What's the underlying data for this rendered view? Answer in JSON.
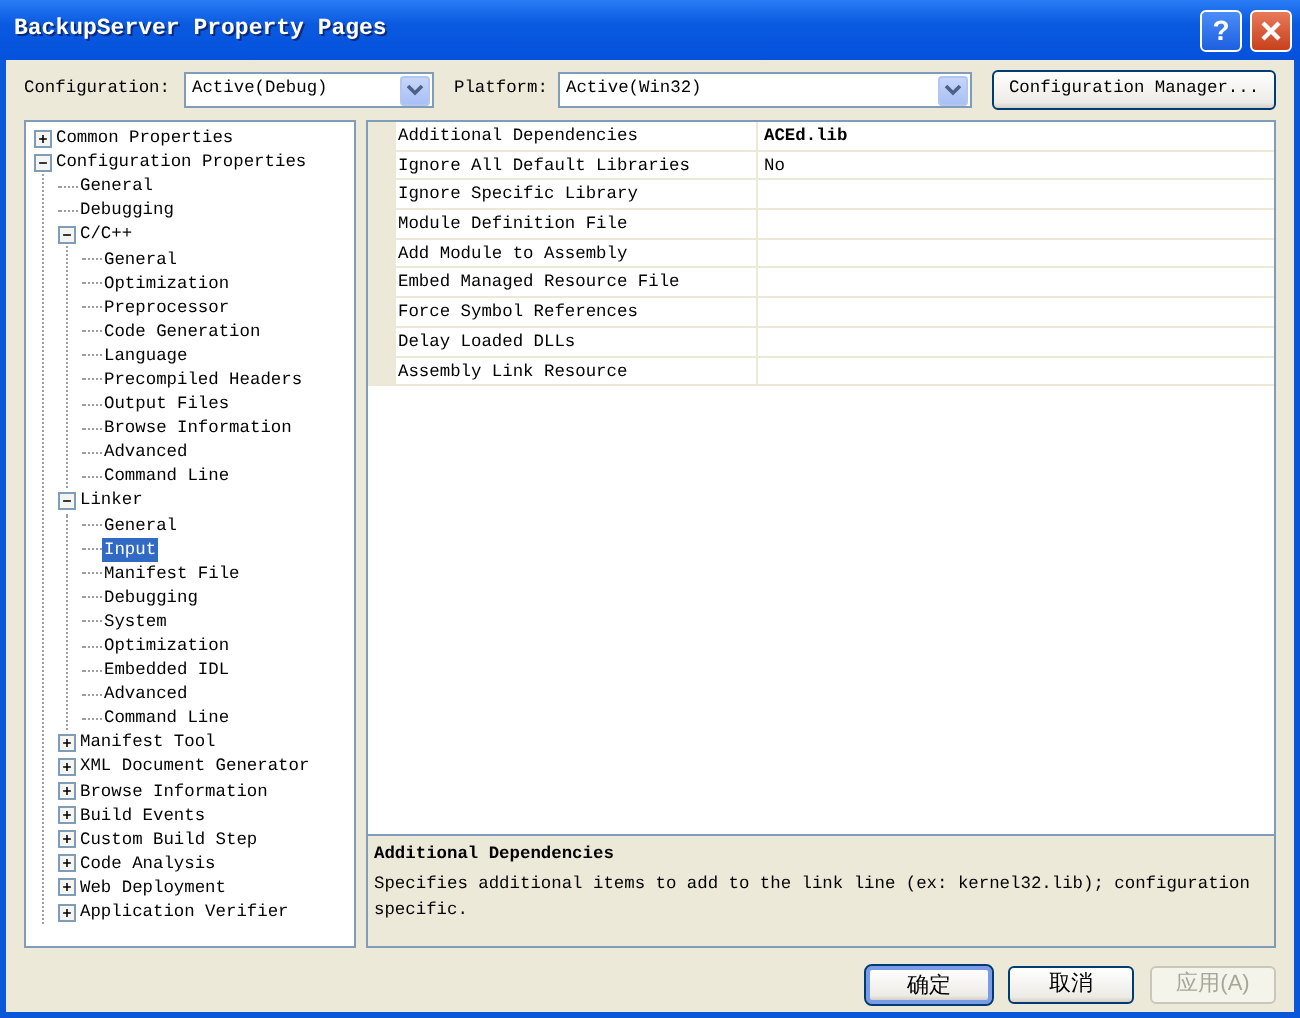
{
  "window": {
    "title": "BackupServer Property Pages",
    "help": "?"
  },
  "toolbar": {
    "configuration_label": "Configuration:",
    "configuration_value": "Active(Debug)",
    "platform_label": "Platform:",
    "platform_value": "Active(Win32)",
    "manager_button": "Configuration Manager..."
  },
  "tree": [
    {
      "label": "Common Properties",
      "expanded": false,
      "selected": false
    },
    {
      "label": "Configuration Properties",
      "expanded": true,
      "selected": false,
      "children": [
        {
          "label": "General",
          "selected": false
        },
        {
          "label": "Debugging",
          "selected": false
        },
        {
          "label": "C/C++",
          "expanded": true,
          "selected": false,
          "children": [
            {
              "label": "General",
              "selected": false
            },
            {
              "label": "Optimization",
              "selected": false
            },
            {
              "label": "Preprocessor",
              "selected": false
            },
            {
              "label": "Code Generation",
              "selected": false
            },
            {
              "label": "Language",
              "selected": false
            },
            {
              "label": "Precompiled Headers",
              "selected": false
            },
            {
              "label": "Output Files",
              "selected": false
            },
            {
              "label": "Browse Information",
              "selected": false
            },
            {
              "label": "Advanced",
              "selected": false
            },
            {
              "label": "Command Line",
              "selected": false
            }
          ]
        },
        {
          "label": "Linker",
          "expanded": true,
          "selected": false,
          "children": [
            {
              "label": "General",
              "selected": false
            },
            {
              "label": "Input",
              "selected": true
            },
            {
              "label": "Manifest File",
              "selected": false
            },
            {
              "label": "Debugging",
              "selected": false
            },
            {
              "label": "System",
              "selected": false
            },
            {
              "label": "Optimization",
              "selected": false
            },
            {
              "label": "Embedded IDL",
              "selected": false
            },
            {
              "label": "Advanced",
              "selected": false
            },
            {
              "label": "Command Line",
              "selected": false
            }
          ]
        },
        {
          "label": "Manifest Tool",
          "expanded": false,
          "selected": false
        },
        {
          "label": "XML Document Generator",
          "expanded": false,
          "selected": false
        },
        {
          "label": "Browse Information",
          "expanded": false,
          "selected": false
        },
        {
          "label": "Build Events",
          "expanded": false,
          "selected": false
        },
        {
          "label": "Custom Build Step",
          "expanded": false,
          "selected": false
        },
        {
          "label": "Code Analysis",
          "expanded": false,
          "selected": false
        },
        {
          "label": "Web Deployment",
          "expanded": false,
          "selected": false
        },
        {
          "label": "Application Verifier",
          "expanded": false,
          "selected": false
        }
      ]
    }
  ],
  "properties": [
    {
      "name": "Additional Dependencies",
      "value": "ACEd.lib",
      "modified": true
    },
    {
      "name": "Ignore All Default Libraries",
      "value": "No",
      "modified": false
    },
    {
      "name": "Ignore Specific Library"
    },
    {
      "name": "Module Definition File"
    },
    {
      "name": "Add Module to Assembly"
    },
    {
      "name": "Embed Managed Resource File"
    },
    {
      "name": "Force Symbol References"
    },
    {
      "name": "Delay Loaded DLLs"
    },
    {
      "name": "Assembly Link Resource"
    }
  ],
  "description": {
    "title": "Additional Dependencies",
    "text": "Specifies additional items to add to the link line (ex: kernel32.lib); configuration specific."
  },
  "buttons": [
    {
      "label": "确定",
      "kind": "default",
      "disabled": false
    },
    {
      "label": "取消",
      "kind": "normal",
      "disabled": false
    },
    {
      "label": "应用(A)",
      "kind": "normal",
      "disabled": true
    }
  ]
}
